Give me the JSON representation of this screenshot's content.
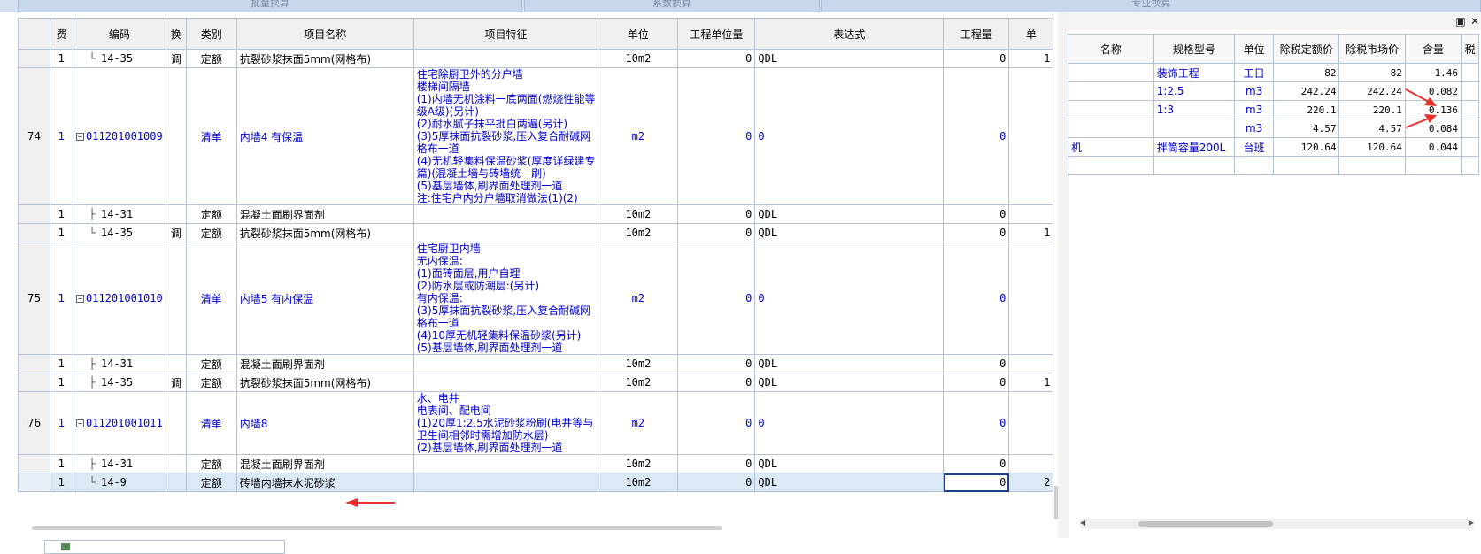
{
  "top_tabs": [
    "批量换算",
    "系数换算",
    "专业换算"
  ],
  "grid": {
    "headers": [
      "",
      "费",
      "编码",
      "换",
      "类别",
      "项目名称",
      "项目特征",
      "单位",
      "工程单位量",
      "表达式",
      "工程量",
      "单"
    ],
    "rows": [
      {
        "num": "",
        "fee": "1",
        "code": "14-35",
        "swap": "调",
        "cat": "定额",
        "name": "抗裂砂浆抹面5mm(网格布)",
        "unit": "10m2",
        "unitqty": "0",
        "expr": "QDL",
        "qty": "0",
        "extra": "1"
      },
      {
        "num": "74",
        "fee": "1",
        "code": "011201001009",
        "swap": "",
        "cat": "清单",
        "name": "内墙4 有保温",
        "features": [
          "住宅除厨卫外的分户墙",
          "楼梯间隔墙",
          "(1)内墙无机涂料一底两面(燃烧性能等",
          "级A级)(另计)",
          "(2)耐水腻子抹平批白两遍(另计)",
          "(3)5厚抹面抗裂砂浆,压入复合耐碱网",
          "格布一道",
          "(4)无机轻集料保温砂浆(厚度详绿建专",
          "篇)(混凝土墙与砖墙统一刷)",
          "(5)基层墙体,刷界面处理剂一道",
          "注:住宅户内分户墙取消做法(1)(2)"
        ],
        "unit": "m2",
        "unitqty": "0",
        "expr": "0",
        "qty": "0",
        "extra": ""
      },
      {
        "num": "",
        "fee": "1",
        "code": "14-31",
        "swap": "",
        "cat": "定额",
        "name": "混凝土面刷界面剂",
        "unit": "10m2",
        "unitqty": "0",
        "expr": "QDL",
        "qty": "0",
        "extra": ""
      },
      {
        "num": "",
        "fee": "1",
        "code": "14-35",
        "swap": "调",
        "cat": "定额",
        "name": "抗裂砂浆抹面5mm(网格布)",
        "unit": "10m2",
        "unitqty": "0",
        "expr": "QDL",
        "qty": "0",
        "extra": "1"
      },
      {
        "num": "75",
        "fee": "1",
        "code": "011201001010",
        "swap": "",
        "cat": "清单",
        "name": "内墙5 有内保温",
        "features": [
          "住宅厨卫内墙",
          "无内保温:",
          "(1)面砖面层,用户自理",
          "(2)防水层或防潮层:(另计)",
          "有内保温:",
          "(3)5厚抹面抗裂砂浆,压入复合耐碱网",
          "格布一道",
          "(4)10厚无机轻集料保温砂浆(另计)",
          "(5)基层墙体,刷界面处理剂一道"
        ],
        "unit": "m2",
        "unitqty": "0",
        "expr": "0",
        "qty": "0",
        "extra": ""
      },
      {
        "num": "",
        "fee": "1",
        "code": "14-31",
        "swap": "",
        "cat": "定额",
        "name": "混凝土面刷界面剂",
        "unit": "10m2",
        "unitqty": "0",
        "expr": "QDL",
        "qty": "0",
        "extra": ""
      },
      {
        "num": "",
        "fee": "1",
        "code": "14-35",
        "swap": "调",
        "cat": "定额",
        "name": "抗裂砂浆抹面5mm(网格布)",
        "unit": "10m2",
        "unitqty": "0",
        "expr": "QDL",
        "qty": "0",
        "extra": "1"
      },
      {
        "num": "76",
        "fee": "1",
        "code": "011201001011",
        "swap": "",
        "cat": "清单",
        "name": "内墙8",
        "features": [
          "水、电井",
          "电表间、配电间",
          "(1)20厚1:2.5水泥砂浆粉刷(电井等与",
          "卫生间相邻时需增加防水层)",
          "(2)基层墙体,刷界面处理剂一道"
        ],
        "unit": "m2",
        "unitqty": "0",
        "expr": "0",
        "qty": "0",
        "extra": ""
      },
      {
        "num": "",
        "fee": "1",
        "code": "14-31",
        "swap": "",
        "cat": "定额",
        "name": "混凝土面刷界面剂",
        "unit": "10m2",
        "unitqty": "0",
        "expr": "QDL",
        "qty": "0",
        "extra": ""
      },
      {
        "num": "",
        "fee": "1",
        "code": "14-9",
        "swap": "",
        "cat": "定额",
        "name": "砖墙内墙抹水泥砂浆",
        "unit": "10m2",
        "unitqty": "0",
        "expr": "QDL",
        "qty": "0",
        "extra": "2"
      }
    ]
  },
  "materials": {
    "headers": [
      "名称",
      "规格型号",
      "单位",
      "除税定额价",
      "除税市场价",
      "含量",
      "税"
    ],
    "rows": [
      {
        "name": "",
        "spec": "装饰工程",
        "unit": "工日",
        "quota": "82",
        "market": "82",
        "content": "1.46"
      },
      {
        "name": "",
        "spec": "1:2.5",
        "unit": "m3",
        "quota": "242.24",
        "market": "242.24",
        "content": "0.082"
      },
      {
        "name": "",
        "spec": "1:3",
        "unit": "m3",
        "quota": "220.1",
        "market": "220.1",
        "content": "0.136"
      },
      {
        "name": "",
        "spec": "",
        "unit": "m3",
        "quota": "4.57",
        "market": "4.57",
        "content": "0.084"
      },
      {
        "name": "机",
        "spec": "拌筒容量200L",
        "unit": "台班",
        "quota": "120.64",
        "market": "120.64",
        "content": "0.044"
      },
      {
        "name": "",
        "spec": "",
        "unit": "",
        "quota": "",
        "market": "",
        "content": ""
      }
    ]
  },
  "controls": {
    "restore_glyph": "▣",
    "close_glyph": "✕",
    "scroll_left_glyph": "◀",
    "scroll_right_glyph": "▶"
  },
  "colors": {
    "accent": "#0000cc",
    "annotation_arrow": "#e8302a",
    "selection": "#dbe9f7"
  }
}
